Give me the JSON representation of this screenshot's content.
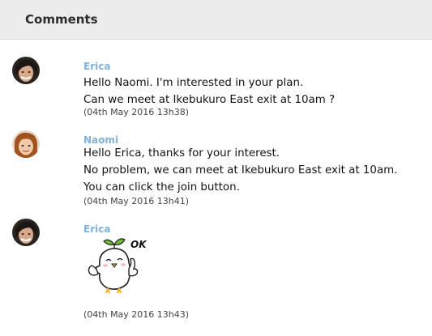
{
  "header": {
    "title": "Comments"
  },
  "comments": [
    {
      "author": "Erica",
      "lines": [
        "Hello Naomi. I'm interested in your plan.",
        "Can we meet at Ikebukuro East exit at 10am ?"
      ],
      "timestamp": "(04th May 2016 13h38)",
      "avatar": "avatar-erica"
    },
    {
      "author": "Naomi",
      "lines": [
        "Hello Erica, thanks for your interest.",
        "No problem, we can meet at Ikebukuro East exit at 10am.",
        "You can click the join button."
      ],
      "timestamp": "(04th May 2016 13h41)",
      "avatar": "avatar-naomi"
    },
    {
      "author": "Erica",
      "sticker": {
        "text": "OK!",
        "icon": "bird-ok-sticker-icon"
      },
      "timestamp": "(04th May 2016 13h43)",
      "avatar": "avatar-erica"
    }
  ],
  "colors": {
    "author": "#7fb2dc",
    "header_bg": "#ececec",
    "sticker_leaf": "#6abf3a"
  }
}
